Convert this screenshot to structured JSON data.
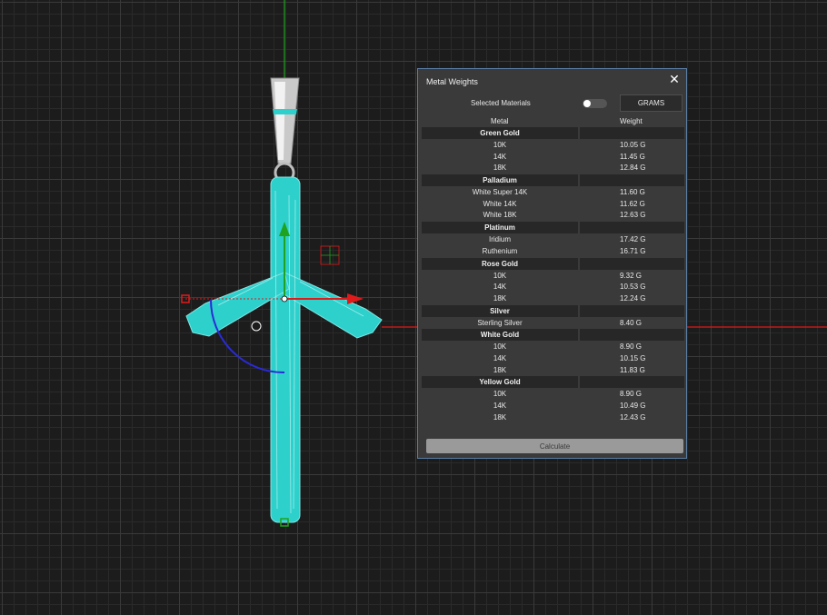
{
  "panel": {
    "title": "Metal Weights",
    "close_icon": "✕",
    "selected_materials_label": "Selected Materials",
    "units_button": "GRAMS",
    "col_metal": "Metal",
    "col_weight": "Weight",
    "calculate_label": "Calculate",
    "groups": [
      {
        "name": "Green Gold",
        "items": [
          {
            "name": "10K",
            "weight": "10.05 G"
          },
          {
            "name": "14K",
            "weight": "11.45 G"
          },
          {
            "name": "18K",
            "weight": "12.84 G"
          }
        ]
      },
      {
        "name": "Palladium",
        "items": [
          {
            "name": "White Super 14K",
            "weight": "11.60 G"
          },
          {
            "name": "White 14K",
            "weight": "11.62 G"
          },
          {
            "name": "White 18K",
            "weight": "12.63 G"
          }
        ]
      },
      {
        "name": "Platinum",
        "items": [
          {
            "name": "Iridium",
            "weight": "17.42 G"
          },
          {
            "name": "Ruthenium",
            "weight": "16.71 G"
          }
        ]
      },
      {
        "name": "Rose Gold",
        "items": [
          {
            "name": "10K",
            "weight": "9.32 G"
          },
          {
            "name": "14K",
            "weight": "10.53 G"
          },
          {
            "name": "18K",
            "weight": "12.24 G"
          }
        ]
      },
      {
        "name": "Silver",
        "items": [
          {
            "name": "Sterling Silver",
            "weight": "8.40 G"
          }
        ]
      },
      {
        "name": "White Gold",
        "items": [
          {
            "name": "10K",
            "weight": "8.90 G"
          },
          {
            "name": "14K",
            "weight": "10.15 G"
          },
          {
            "name": "18K",
            "weight": "11.83 G"
          }
        ]
      },
      {
        "name": "Yellow Gold",
        "items": [
          {
            "name": "10K",
            "weight": "8.90 G"
          },
          {
            "name": "14K",
            "weight": "10.49 G"
          },
          {
            "name": "18K",
            "weight": "12.43 G"
          }
        ]
      }
    ]
  },
  "viewport": {
    "model_color": "#2ed0cc",
    "x_axis_color": "#e01a1a",
    "y_axis_color": "#1fa21f",
    "gizmo_arc_color": "#2a2ad8"
  }
}
